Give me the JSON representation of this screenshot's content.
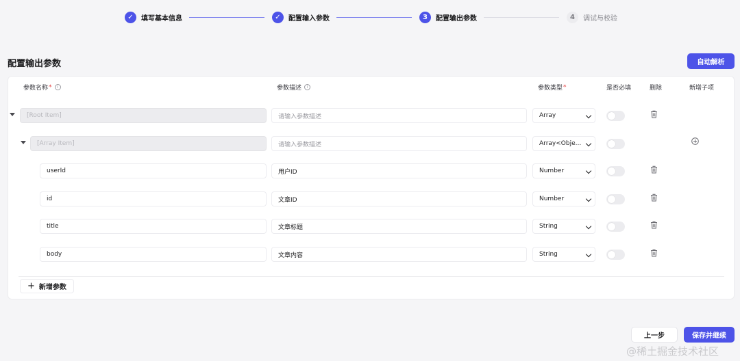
{
  "steps": [
    {
      "num": "✓",
      "label": "填写基本信息",
      "state": "done"
    },
    {
      "num": "✓",
      "label": "配置输入参数",
      "state": "done"
    },
    {
      "num": "3",
      "label": "配置输出参数",
      "state": "active"
    },
    {
      "num": "4",
      "label": "调试与校验",
      "state": "todo"
    }
  ],
  "section_title": "配置输出参数",
  "auto_parse_label": "自动解析",
  "table": {
    "headers": {
      "name": "参数名称",
      "desc": "参数描述",
      "type": "参数类型",
      "required": "是否必填",
      "delete": "删除",
      "add_child": "新增子项"
    },
    "required_mark": "*",
    "rows": [
      {
        "name": "[Root Item]",
        "desc": "",
        "desc_placeholder": "请输入参数描述",
        "type": "Array"
      },
      {
        "name": "[Array Item]",
        "desc": "",
        "desc_placeholder": "请输入参数描述",
        "type": "Array<Obje..."
      },
      {
        "name": "userId",
        "desc": "用户ID",
        "type": "Number"
      },
      {
        "name": "id",
        "desc": "文章ID",
        "type": "Number"
      },
      {
        "name": "title",
        "desc": "文章标题",
        "type": "String"
      },
      {
        "name": "body",
        "desc": "文章内容",
        "type": "String"
      }
    ]
  },
  "add_param_label": "新增参数",
  "footer": {
    "prev_label": "上一步",
    "save_label": "保存并继续"
  },
  "watermark": "@稀土掘金技术社区",
  "colors": {
    "accent": "#4d53e8",
    "danger": "#e23c3c"
  },
  "icons": {
    "caret": "caret-down-icon",
    "info": "info-icon",
    "trash": "trash-icon",
    "add_child": "plus-circle-icon",
    "plus": "plus-icon",
    "check": "check-icon"
  }
}
